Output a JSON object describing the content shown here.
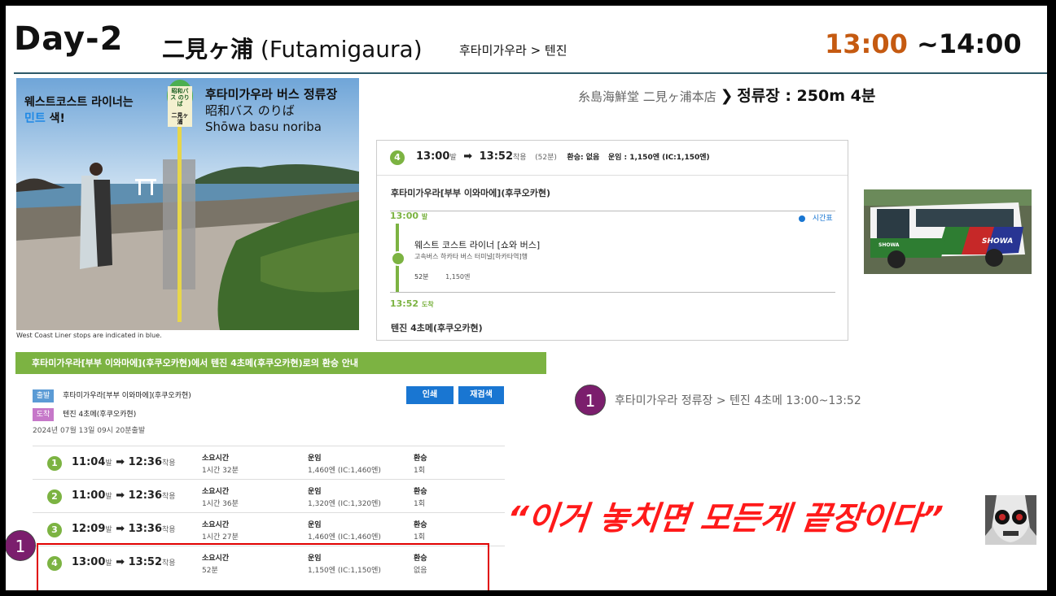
{
  "header": {
    "day": "Day-2",
    "place_cn": "二見ヶ浦",
    "place_en": "(Futamigaura)",
    "route": "후타미가우라 > 텐진",
    "time_start": "13:00",
    "time_rest": " ~14:00"
  },
  "photo": {
    "label_line1": "웨스트코스트 라이너는",
    "label_highlight": "민트",
    "label_line2_rest": " 색!",
    "stop_title": "후타미가우라 버스 정류장",
    "stop_jp": "昭和バス のりば",
    "stop_romaji": "Shōwa basu noriba",
    "sign_top": "昭和バス のりば",
    "sign_mid": "二見ヶ浦",
    "caption": "West Coast Liner stops are indicated in blue."
  },
  "walk": {
    "from": "糸島海鮮堂 二見ヶ浦本店",
    "arrow": "❯",
    "to": "정류장 : 250m 4분"
  },
  "card": {
    "num": "4",
    "dep": "13:00",
    "dep_suffix": "발",
    "arr": "13:52",
    "arr_suffix": "착용",
    "duration": "(52분)",
    "transfer": "환승: 없음",
    "fare": "운임 : 1,150엔 (IC:1,150엔)",
    "origin": "후타미가우라[부부 이와마에](후쿠오카현)",
    "dep_time": "13:00",
    "dep_label": "발",
    "timetable": "시간표",
    "line_name": "웨스트 코스트 라이너 [쇼와 버스]",
    "line_desc": "고속버스 하카타 버스 터미널[하카타역]행",
    "ride_min": "52분",
    "ride_fare": "1,150엔",
    "arr_time": "13:52",
    "arr_label": "도착",
    "dest": "텐진 4초메(후쿠오카현)"
  },
  "bus_photo": {
    "brand": "SHOWA"
  },
  "panel": {
    "title": "후타미가우라[부부 이와마에](후쿠오카현)에서 텐진 4초메(후쿠오카현)로의 환승 안내",
    "dep_tag": "출발",
    "dep_name": "후타미가우라[부부 이와마에](후쿠오카현)",
    "arr_tag": "도착",
    "arr_name": "텐진 4초메(후쿠오카현)",
    "date": "2024년 07월 13일 09시 20분출발",
    "print_btn": "인쇄",
    "research_btn": "재검색",
    "col_time": "소요시간",
    "col_fare": "운임",
    "col_transfer": "환승",
    "rows": [
      {
        "num": "1",
        "dep": "11:04",
        "arr": "12:36",
        "dep_suffix": "발",
        "arr_suffix": "착용",
        "time": "1시간 32분",
        "fare": "1,460엔 (IC:1,460엔)",
        "transfer": "1회"
      },
      {
        "num": "2",
        "dep": "11:00",
        "arr": "12:36",
        "dep_suffix": "발",
        "arr_suffix": "착용",
        "time": "1시간 36분",
        "fare": "1,320엔 (IC:1,320엔)",
        "transfer": "1회"
      },
      {
        "num": "3",
        "dep": "12:09",
        "arr": "13:36",
        "dep_suffix": "발",
        "arr_suffix": "착용",
        "time": "1시간 27분",
        "fare": "1,460엔 (IC:1,460엔)",
        "transfer": "1회"
      },
      {
        "num": "4",
        "dep": "13:00",
        "arr": "13:52",
        "dep_suffix": "발",
        "arr_suffix": "착용",
        "time": "52분",
        "fare": "1,150엔 (IC:1,150엔)",
        "transfer": "없음"
      }
    ],
    "arrow": "➡"
  },
  "badge": {
    "num": "1",
    "text": "후타미가우라 정류장 > 텐진 4초메 13:00~13:52"
  },
  "quote": "“이거 놓치면 모든게 끝장이다”",
  "colors": {
    "accent_orange": "#c55a11",
    "green": "#7cb342",
    "purple": "#7b1e6d",
    "quote_red": "#ff1a1a",
    "button_blue": "#1976d2"
  }
}
